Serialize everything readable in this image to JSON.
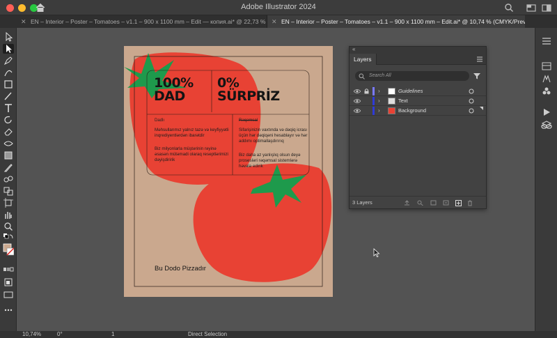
{
  "app": {
    "title": "Adobe Illustrator 2024"
  },
  "tabs": [
    {
      "label": "EN – Interior – Poster – Tomatoes – v1.1 – 900 x 1100 mm – Edit — копия.ai* @ 22,73 % (C..."
    },
    {
      "label": "EN – Interior – Poster – Tomatoes – v1.1 – 900 x 1100 mm – Edit.ai* @ 10,74 % (CMYK/Preview)"
    }
  ],
  "poster": {
    "headline_left": [
      "100%",
      "DAD"
    ],
    "headline_right": [
      "0%",
      "SÜRPRİZ"
    ],
    "col1_head": "Dadlı",
    "col1_p1": "Məhsullarımız yalnız tazə və keyfiyyətli inqrediyentlərdən ibarətdir",
    "col1_p2": "Biz milyonlarla müştərinin rəyinə əsasən mütəmadi olaraq reseptlərimizi dəyişdiririk",
    "col2_head": "Rəqəmsal",
    "col2_p1": "Sifarişinizin vaxtında və dəqiq icrası üçün hər dəqiqəni hesablayır və hər addımı optimallaşdırırıq",
    "col2_p2": "Biz daha az yanlışlıq olsun deyə prosesləri rəqəmsal sistemlərə həvalə edirik",
    "brand": "Bu Dodo Pizzadır"
  },
  "layers_panel": {
    "tab": "Layers",
    "search_placeholder": "Search All",
    "layers": [
      {
        "name": "Guidelines",
        "color": "#7a7aff"
      },
      {
        "name": "Text",
        "color": "#2f3bd6"
      },
      {
        "name": "Background",
        "color": "#2f3bd6"
      }
    ],
    "count": "3 Layers"
  },
  "status": {
    "zoom": "10,74%",
    "rotation": "0°",
    "artboard": "1",
    "tool": "Direct Selection"
  },
  "colors": {
    "accent": "#e84234",
    "tomato_leaf": "#1e9a4c",
    "artboard": "#caa88e"
  }
}
